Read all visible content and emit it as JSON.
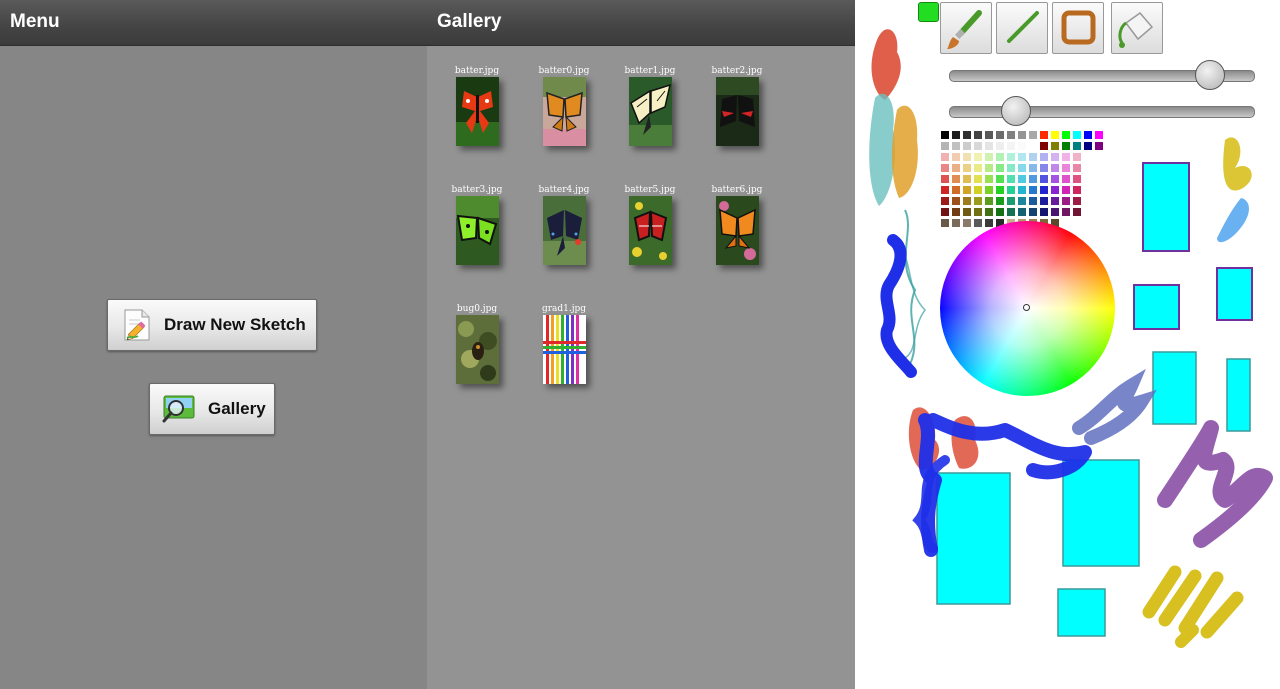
{
  "menu": {
    "title": "Menu",
    "draw_new_sketch_label": "Draw New Sketch",
    "gallery_label": "Gallery"
  },
  "gallery": {
    "title": "Gallery",
    "items": [
      {
        "name": "batter.jpg"
      },
      {
        "name": "batter0.jpg"
      },
      {
        "name": "batter1.jpg"
      },
      {
        "name": "batter2.jpg"
      },
      {
        "name": "batter3.jpg"
      },
      {
        "name": "batter4.jpg"
      },
      {
        "name": "batter5.jpg"
      },
      {
        "name": "batter6.jpg"
      },
      {
        "name": "bug0.jpg"
      },
      {
        "name": "grad1.jpg"
      }
    ]
  },
  "sketch": {
    "tools": [
      "paintbrush-icon",
      "line-icon",
      "rectangle-icon",
      "fill-bucket-icon"
    ],
    "indicator_color": "#22dd22",
    "brush_size_level": 0.86,
    "opacity_level": 0.22,
    "palette": {
      "grays": [
        "#000000",
        "#1c1c1c",
        "#303030",
        "#444444",
        "#585858",
        "#6c6c6c",
        "#808080",
        "#949494",
        "#a8a8a8"
      ],
      "accents": [
        "#ff2a00",
        "#ffff00",
        "#00ff00",
        "#00ffff",
        "#0000ff",
        "#ff00ff"
      ]
    }
  }
}
